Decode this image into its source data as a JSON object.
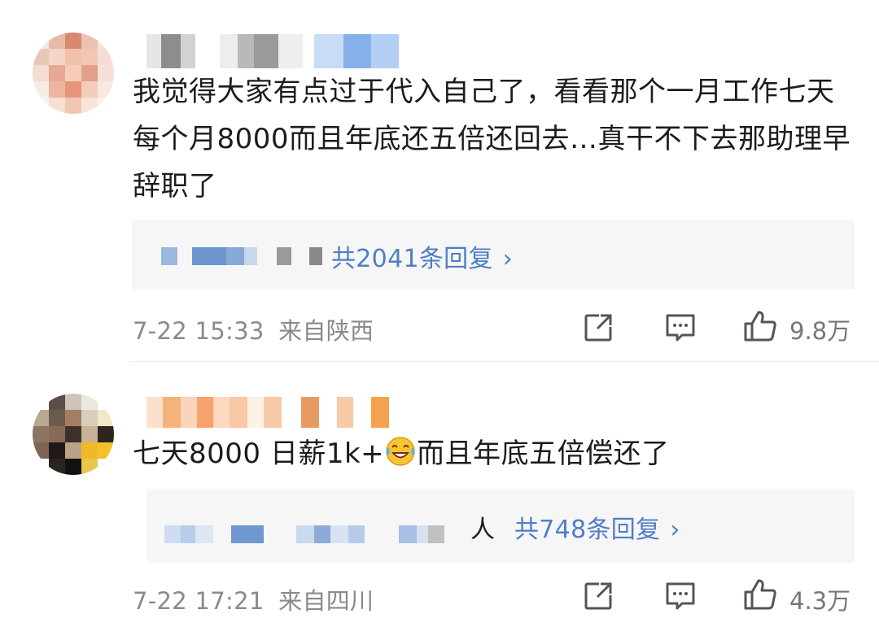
{
  "comments": [
    {
      "text": "我觉得大家有点过于代入自己了，看看那个一月工作七天每个月8000而且年底还五倍还回去…真干不下去那助理早辞职了",
      "replies_label": "共2041条回复",
      "time": "7-22 15:33",
      "location": "来自陕西",
      "likes": "9.8万"
    },
    {
      "text_before_emoji": "七天8000 日薪1k+",
      "emoji": "laughing-tears-emoji",
      "text_after_emoji": "而且年底五倍偿还了",
      "reply_suffix": "人",
      "replies_label": "共748条回复",
      "time": "7-22 17:21",
      "location": "来自四川",
      "likes": "4.3万"
    }
  ],
  "icons": {
    "share": "share-icon",
    "comment": "comment-icon",
    "like": "thumbs-up-icon",
    "chevron": "chevron-right-icon"
  },
  "colors": {
    "link": "#4f7ec6",
    "meta": "#8a8a8a",
    "reply_bg": "#f6f6f6"
  }
}
